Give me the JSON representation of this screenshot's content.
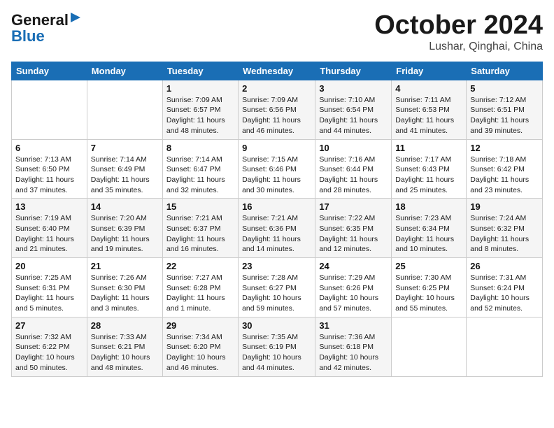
{
  "logo": {
    "general": "General",
    "blue": "Blue",
    "triangle": "▶"
  },
  "title": "October 2024",
  "location": "Lushar, Qinghai, China",
  "weekdays": [
    "Sunday",
    "Monday",
    "Tuesday",
    "Wednesday",
    "Thursday",
    "Friday",
    "Saturday"
  ],
  "weeks": [
    [
      {
        "day": "",
        "sunrise": "",
        "sunset": "",
        "daylight": ""
      },
      {
        "day": "",
        "sunrise": "",
        "sunset": "",
        "daylight": ""
      },
      {
        "day": "1",
        "sunrise": "Sunrise: 7:09 AM",
        "sunset": "Sunset: 6:57 PM",
        "daylight": "Daylight: 11 hours and 48 minutes."
      },
      {
        "day": "2",
        "sunrise": "Sunrise: 7:09 AM",
        "sunset": "Sunset: 6:56 PM",
        "daylight": "Daylight: 11 hours and 46 minutes."
      },
      {
        "day": "3",
        "sunrise": "Sunrise: 7:10 AM",
        "sunset": "Sunset: 6:54 PM",
        "daylight": "Daylight: 11 hours and 44 minutes."
      },
      {
        "day": "4",
        "sunrise": "Sunrise: 7:11 AM",
        "sunset": "Sunset: 6:53 PM",
        "daylight": "Daylight: 11 hours and 41 minutes."
      },
      {
        "day": "5",
        "sunrise": "Sunrise: 7:12 AM",
        "sunset": "Sunset: 6:51 PM",
        "daylight": "Daylight: 11 hours and 39 minutes."
      }
    ],
    [
      {
        "day": "6",
        "sunrise": "Sunrise: 7:13 AM",
        "sunset": "Sunset: 6:50 PM",
        "daylight": "Daylight: 11 hours and 37 minutes."
      },
      {
        "day": "7",
        "sunrise": "Sunrise: 7:14 AM",
        "sunset": "Sunset: 6:49 PM",
        "daylight": "Daylight: 11 hours and 35 minutes."
      },
      {
        "day": "8",
        "sunrise": "Sunrise: 7:14 AM",
        "sunset": "Sunset: 6:47 PM",
        "daylight": "Daylight: 11 hours and 32 minutes."
      },
      {
        "day": "9",
        "sunrise": "Sunrise: 7:15 AM",
        "sunset": "Sunset: 6:46 PM",
        "daylight": "Daylight: 11 hours and 30 minutes."
      },
      {
        "day": "10",
        "sunrise": "Sunrise: 7:16 AM",
        "sunset": "Sunset: 6:44 PM",
        "daylight": "Daylight: 11 hours and 28 minutes."
      },
      {
        "day": "11",
        "sunrise": "Sunrise: 7:17 AM",
        "sunset": "Sunset: 6:43 PM",
        "daylight": "Daylight: 11 hours and 25 minutes."
      },
      {
        "day": "12",
        "sunrise": "Sunrise: 7:18 AM",
        "sunset": "Sunset: 6:42 PM",
        "daylight": "Daylight: 11 hours and 23 minutes."
      }
    ],
    [
      {
        "day": "13",
        "sunrise": "Sunrise: 7:19 AM",
        "sunset": "Sunset: 6:40 PM",
        "daylight": "Daylight: 11 hours and 21 minutes."
      },
      {
        "day": "14",
        "sunrise": "Sunrise: 7:20 AM",
        "sunset": "Sunset: 6:39 PM",
        "daylight": "Daylight: 11 hours and 19 minutes."
      },
      {
        "day": "15",
        "sunrise": "Sunrise: 7:21 AM",
        "sunset": "Sunset: 6:37 PM",
        "daylight": "Daylight: 11 hours and 16 minutes."
      },
      {
        "day": "16",
        "sunrise": "Sunrise: 7:21 AM",
        "sunset": "Sunset: 6:36 PM",
        "daylight": "Daylight: 11 hours and 14 minutes."
      },
      {
        "day": "17",
        "sunrise": "Sunrise: 7:22 AM",
        "sunset": "Sunset: 6:35 PM",
        "daylight": "Daylight: 11 hours and 12 minutes."
      },
      {
        "day": "18",
        "sunrise": "Sunrise: 7:23 AM",
        "sunset": "Sunset: 6:34 PM",
        "daylight": "Daylight: 11 hours and 10 minutes."
      },
      {
        "day": "19",
        "sunrise": "Sunrise: 7:24 AM",
        "sunset": "Sunset: 6:32 PM",
        "daylight": "Daylight: 11 hours and 8 minutes."
      }
    ],
    [
      {
        "day": "20",
        "sunrise": "Sunrise: 7:25 AM",
        "sunset": "Sunset: 6:31 PM",
        "daylight": "Daylight: 11 hours and 5 minutes."
      },
      {
        "day": "21",
        "sunrise": "Sunrise: 7:26 AM",
        "sunset": "Sunset: 6:30 PM",
        "daylight": "Daylight: 11 hours and 3 minutes."
      },
      {
        "day": "22",
        "sunrise": "Sunrise: 7:27 AM",
        "sunset": "Sunset: 6:28 PM",
        "daylight": "Daylight: 11 hours and 1 minute."
      },
      {
        "day": "23",
        "sunrise": "Sunrise: 7:28 AM",
        "sunset": "Sunset: 6:27 PM",
        "daylight": "Daylight: 10 hours and 59 minutes."
      },
      {
        "day": "24",
        "sunrise": "Sunrise: 7:29 AM",
        "sunset": "Sunset: 6:26 PM",
        "daylight": "Daylight: 10 hours and 57 minutes."
      },
      {
        "day": "25",
        "sunrise": "Sunrise: 7:30 AM",
        "sunset": "Sunset: 6:25 PM",
        "daylight": "Daylight: 10 hours and 55 minutes."
      },
      {
        "day": "26",
        "sunrise": "Sunrise: 7:31 AM",
        "sunset": "Sunset: 6:24 PM",
        "daylight": "Daylight: 10 hours and 52 minutes."
      }
    ],
    [
      {
        "day": "27",
        "sunrise": "Sunrise: 7:32 AM",
        "sunset": "Sunset: 6:22 PM",
        "daylight": "Daylight: 10 hours and 50 minutes."
      },
      {
        "day": "28",
        "sunrise": "Sunrise: 7:33 AM",
        "sunset": "Sunset: 6:21 PM",
        "daylight": "Daylight: 10 hours and 48 minutes."
      },
      {
        "day": "29",
        "sunrise": "Sunrise: 7:34 AM",
        "sunset": "Sunset: 6:20 PM",
        "daylight": "Daylight: 10 hours and 46 minutes."
      },
      {
        "day": "30",
        "sunrise": "Sunrise: 7:35 AM",
        "sunset": "Sunset: 6:19 PM",
        "daylight": "Daylight: 10 hours and 44 minutes."
      },
      {
        "day": "31",
        "sunrise": "Sunrise: 7:36 AM",
        "sunset": "Sunset: 6:18 PM",
        "daylight": "Daylight: 10 hours and 42 minutes."
      },
      {
        "day": "",
        "sunrise": "",
        "sunset": "",
        "daylight": ""
      },
      {
        "day": "",
        "sunrise": "",
        "sunset": "",
        "daylight": ""
      }
    ]
  ]
}
